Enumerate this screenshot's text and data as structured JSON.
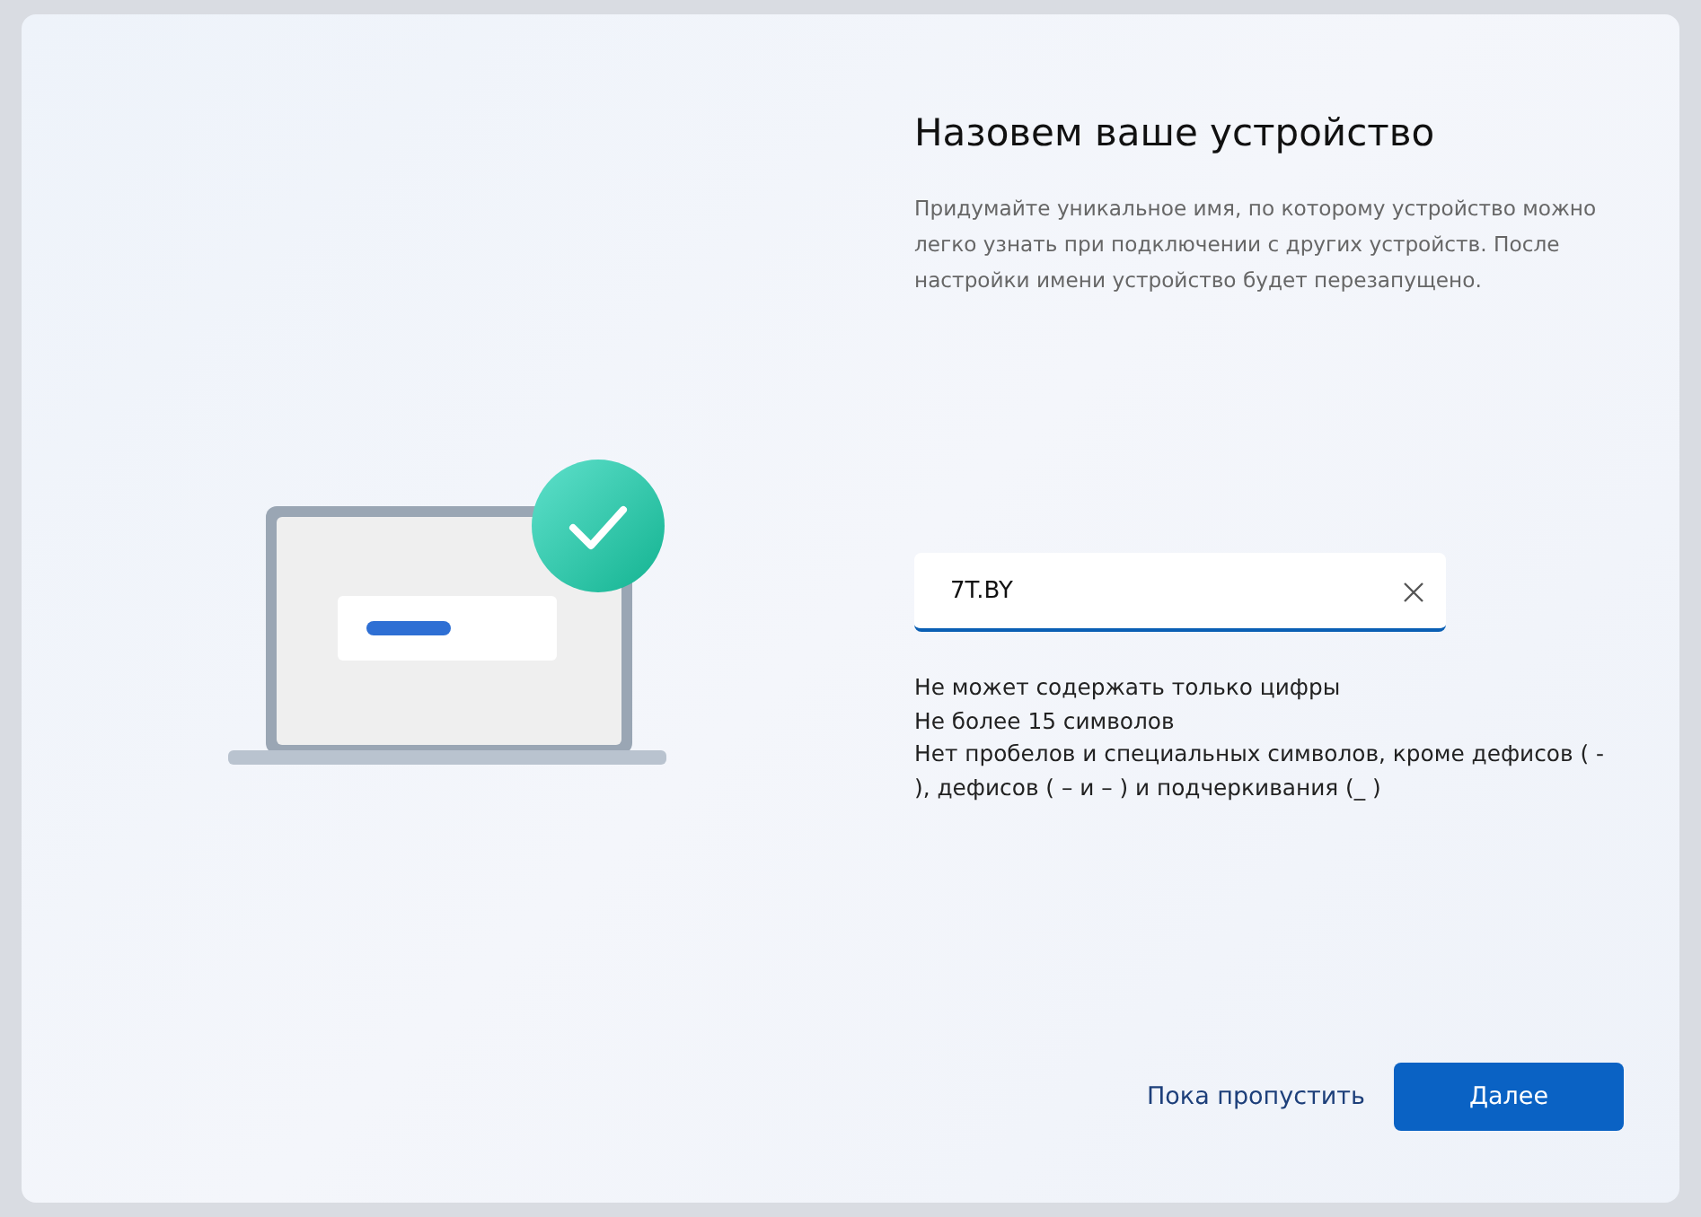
{
  "title": "Назовем ваше устройство",
  "description": "Придумайте уникальное имя, по которому устройство можно легко узнать при подключении с других устройств. После настройки имени устройство будет перезапущено.",
  "name_field": {
    "value": "7T.BY",
    "focused": true
  },
  "rules": [
    "Не может содержать только цифры",
    "Не более 15 символов",
    "Нет пробелов и специальных символов, кроме дефисов ( - ), дефисов ( – и – ) и подчеркивания (_ )"
  ],
  "buttons": [
    {
      "label": "Пока пропустить",
      "kind": "link"
    },
    {
      "label": "Далее",
      "kind": "primary"
    }
  ]
}
